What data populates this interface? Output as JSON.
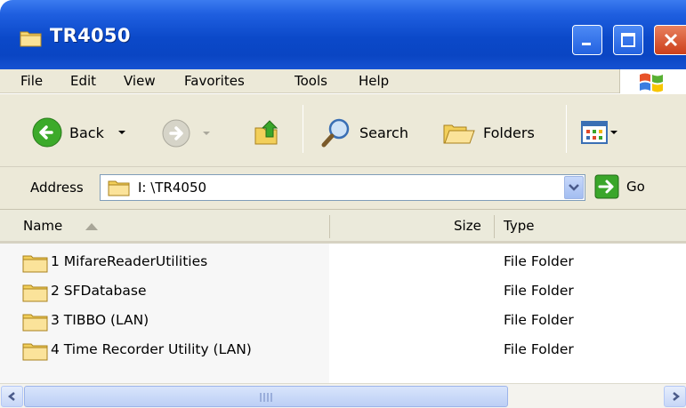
{
  "window": {
    "title": "TR4050"
  },
  "menu": {
    "items": [
      "File",
      "Edit",
      "View",
      "Favorites",
      "Tools",
      "Help"
    ]
  },
  "toolbar": {
    "back_label": "Back",
    "search_label": "Search",
    "folders_label": "Folders"
  },
  "address": {
    "label": "Address",
    "value": "I: \\TR4050",
    "go_label": "Go"
  },
  "columns": {
    "name": "Name",
    "size": "Size",
    "type": "Type"
  },
  "rows": [
    {
      "name": "1 MifareReaderUtilities",
      "size": "",
      "type": "File Folder"
    },
    {
      "name": "2 SFDatabase",
      "size": "",
      "type": "File Folder"
    },
    {
      "name": "3 TIBBO (LAN)",
      "size": "",
      "type": "File Folder"
    },
    {
      "name": "4 Time Recorder Utility (LAN)",
      "size": "",
      "type": "File Folder"
    }
  ],
  "colors": {
    "titlebar": "#0a48c8",
    "chrome": "#ece9d8",
    "close_button": "#cc3f1a"
  },
  "icons": {
    "title": "folder-icon",
    "back": "back-arrow-icon",
    "forward": "forward-arrow-icon",
    "up": "up-folder-icon",
    "search": "search-icon",
    "folders": "folders-icon",
    "views": "views-icon",
    "go": "go-arrow-icon"
  }
}
